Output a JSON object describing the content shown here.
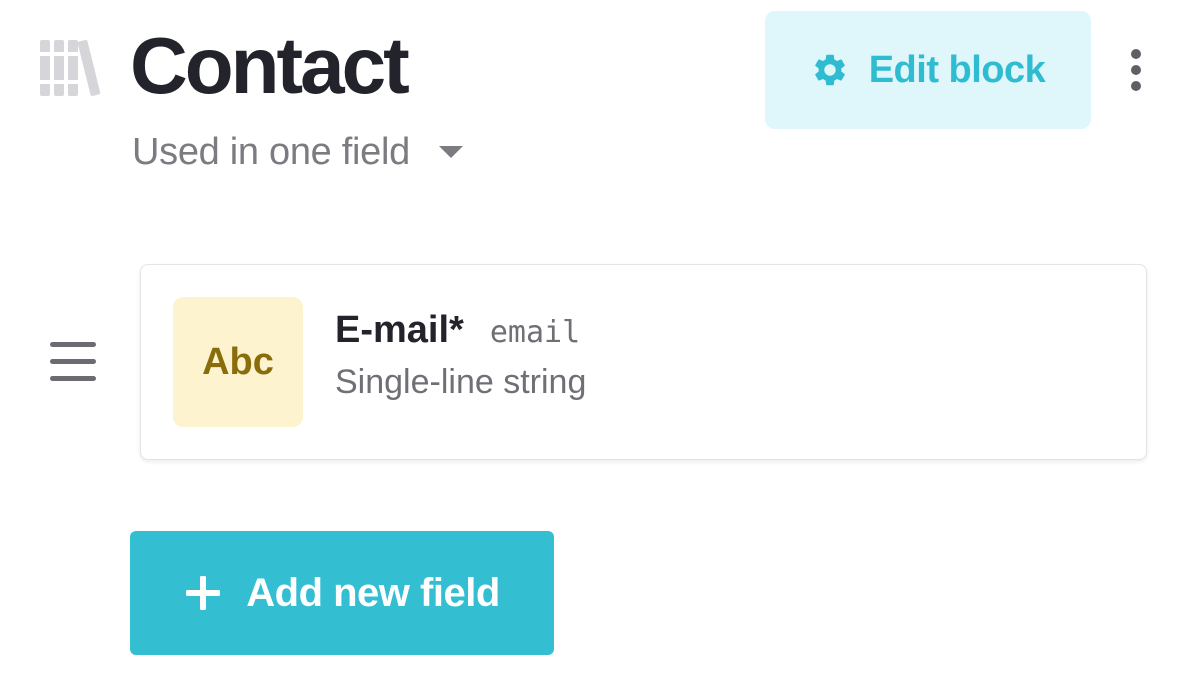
{
  "header": {
    "icon": "library-books-icon",
    "title": "Contact",
    "usage_label": "Used in one field",
    "usage_caret_icon": "caret-down-icon"
  },
  "toolbar": {
    "edit_button_icon": "gear-icon",
    "edit_button_label": "Edit block",
    "more_icon": "more-vertical-icon"
  },
  "fields": [
    {
      "drag_icon": "drag-handle-icon",
      "type_badge": "Abc",
      "name": "E-mail",
      "required_marker": "*",
      "api_key": "email",
      "type_label": "Single-line string"
    }
  ],
  "actions": {
    "add_field_icon": "plus-icon",
    "add_field_label": "Add new field"
  },
  "colors": {
    "accent": "#33bed2",
    "accent_light": "#dff6fb",
    "badge_bg": "#fdf4cf",
    "badge_text": "#8a6d0b",
    "title_text": "#23232b",
    "muted_text": "#7b7b82"
  }
}
